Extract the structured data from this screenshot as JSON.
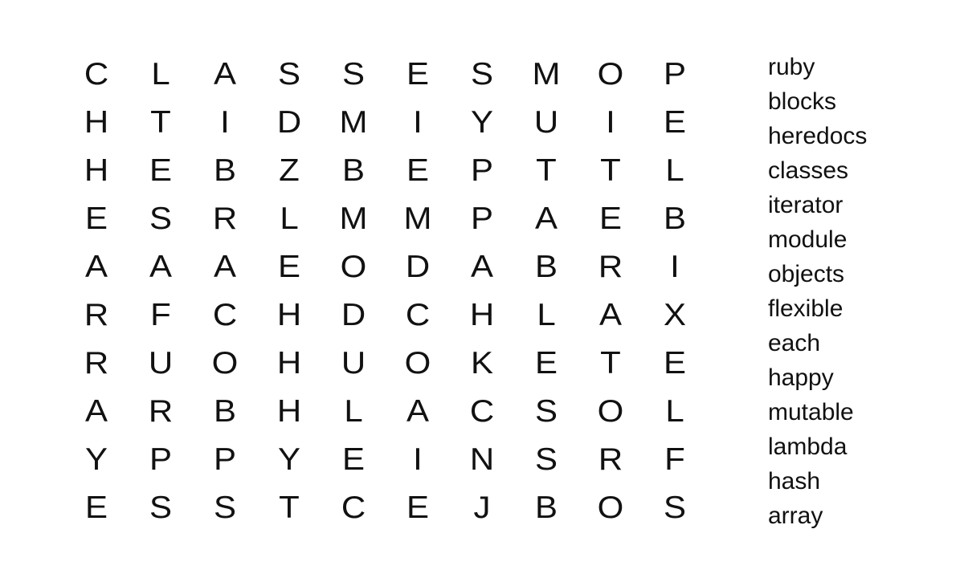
{
  "puzzle": {
    "grid": [
      [
        "C",
        "L",
        "A",
        "S",
        "S",
        "E",
        "S",
        "M",
        "O",
        "P"
      ],
      [
        "H",
        "T",
        "I",
        "D",
        "M",
        "I",
        "Y",
        "U",
        "I",
        "E"
      ],
      [
        "H",
        "E",
        "B",
        "Z",
        "B",
        "E",
        "P",
        "T",
        "T",
        "L"
      ],
      [
        "E",
        "S",
        "R",
        "L",
        "M",
        "M",
        "P",
        "A",
        "E",
        "B"
      ],
      [
        "A",
        "A",
        "A",
        "E",
        "O",
        "D",
        "A",
        "B",
        "R",
        "I"
      ],
      [
        "R",
        "F",
        "C",
        "H",
        "D",
        "C",
        "H",
        "L",
        "A",
        "X"
      ],
      [
        "R",
        "U",
        "O",
        "H",
        "U",
        "O",
        "K",
        "E",
        "T",
        "E"
      ],
      [
        "A",
        "R",
        "B",
        "H",
        "L",
        "A",
        "C",
        "S",
        "O",
        "L"
      ],
      [
        "Y",
        "P",
        "P",
        "Y",
        "E",
        "I",
        "N",
        "S",
        "R",
        "F"
      ],
      [
        "E",
        "S",
        "S",
        "T",
        "C",
        "E",
        "J",
        "B",
        "O",
        "S"
      ]
    ]
  },
  "words": [
    "ruby",
    "blocks",
    "heredocs",
    "classes",
    "iterator",
    "module",
    "objects",
    "flexible",
    "each",
    "happy",
    "mutable",
    "lambda",
    "hash",
    "array"
  ]
}
